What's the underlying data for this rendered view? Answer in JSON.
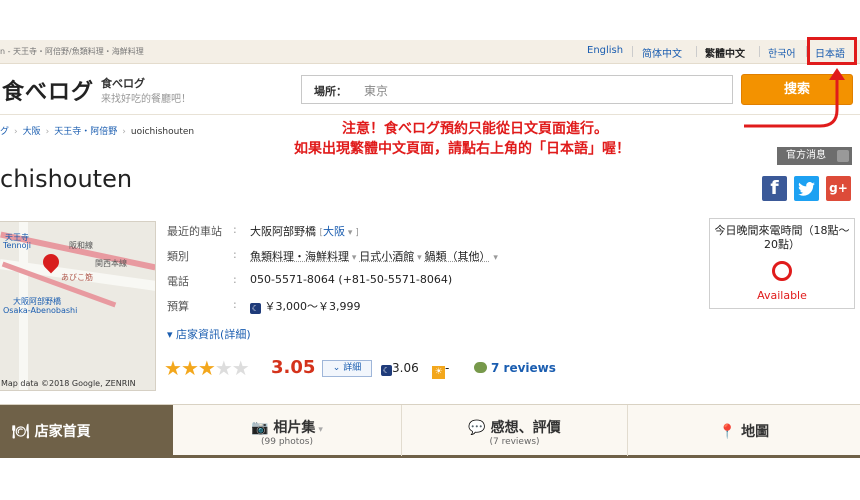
{
  "topbar": {
    "breadcrumb": "n - 天王寺・阿倍野/魚類料理・海鮮料理",
    "languages": [
      "English",
      "简体中文",
      "繁體中文",
      "한국어",
      "日本語"
    ]
  },
  "header": {
    "logo": "食べログ",
    "logo_sub1": "食べログ",
    "logo_sub2": "来找好吃的餐廳吧！",
    "search_label": "場所：",
    "search_value": "東京",
    "search_button": "搜索"
  },
  "breadcrumb": [
    "グ",
    "大阪",
    "天王寺・阿倍野",
    "uoichishouten"
  ],
  "notes": {
    "line1": "注意！食べログ預約只能從日文頁面進行。",
    "line2": "如果出現繁體中文頁面，請點右上角的「日本語」喔！"
  },
  "notice_button": "官方消息",
  "shop_name": "chishouten",
  "social": {
    "facebook": "f",
    "twitter": "t",
    "googleplus": "g+"
  },
  "map": {
    "labels": [
      "天王寺",
      "Tennoji",
      "阪和線",
      "関西本線",
      "あびこ筋",
      "大阪阿部野橋",
      "Osaka-Abenobashi"
    ],
    "credit": "Map data ©2018 Google, ZENRIN"
  },
  "info": {
    "station_key": "最近的車站",
    "station_value": "大阪阿部野橋",
    "station_area": "大阪",
    "category_key": "類別",
    "categories": [
      "魚類料理・海鮮料理",
      "日式小酒館",
      "鍋類（其他）"
    ],
    "phone_key": "電話",
    "phone_value": "050-5571-8064 (+81-50-5571-8064)",
    "budget_key": "預算",
    "budget_value": "￥3,000～￥3,999",
    "detail_link": "店家資訊(詳細)"
  },
  "rating": {
    "stars_filled": 3,
    "stars_total": 5,
    "score": "3.05",
    "detail_button": "詳細",
    "night_score": "3.06",
    "lunch_score": "-",
    "reviews": "7 reviews"
  },
  "availability": {
    "title": "今日晚間來電時間（18點～20點）",
    "status": "Available"
  },
  "nav": {
    "home": "店家首頁",
    "photos": "相片集",
    "photos_count": "(99 photos)",
    "reviews": "感想、評價",
    "reviews_count": "(7 reviews)",
    "map": "地圖"
  },
  "colors": {
    "accent_orange": "#f39200",
    "alert_red": "#e01b1b",
    "nav_brown": "#6f6148",
    "link_blue": "#1a5db0"
  }
}
